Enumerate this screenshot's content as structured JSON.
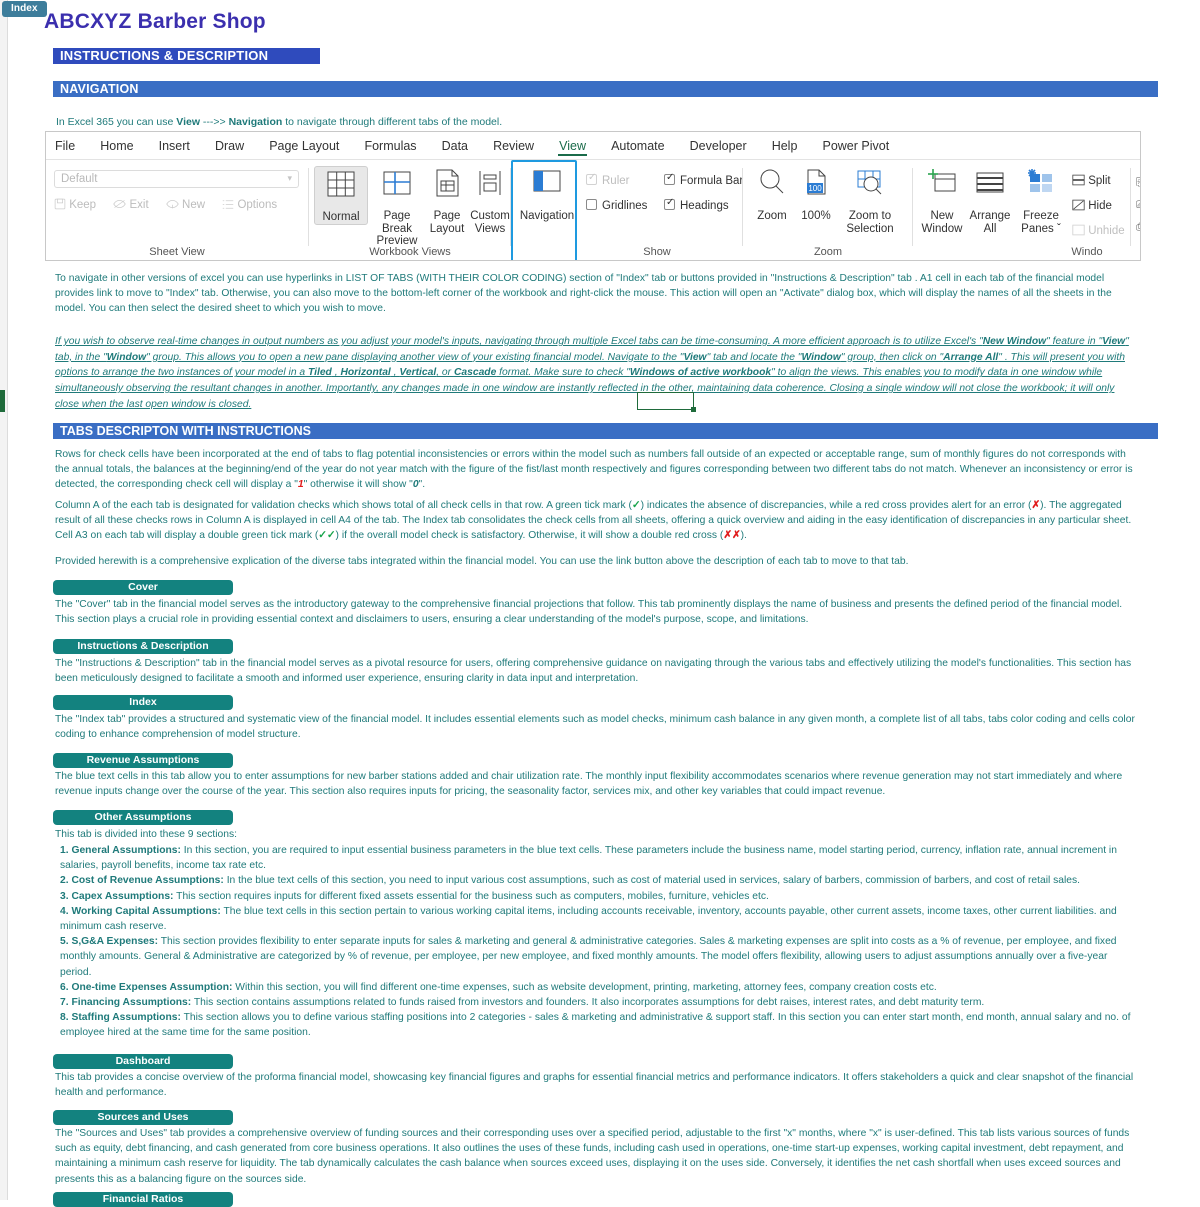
{
  "colors": {
    "teal_text": "#1f7a7a",
    "tab_button": "#13827f",
    "banner_dark_blue": "#2f4bbd",
    "banner_blue": "#3a6ec4",
    "title_purple": "#3b2fae",
    "index_tab": "#3d7d9b",
    "highlight_blue": "#1e9ae0",
    "error_red": "#e01b1b",
    "ok_green": "#16a34a"
  },
  "index_tab_label": "Index",
  "title": "ABCXYZ Barber Shop",
  "banners": {
    "instructions": "INSTRUCTIONS & DESCRIPTION",
    "navigation": "NAVIGATION",
    "tabs_description": "TABS DESCRIPTON WITH INSTRUCTIONS"
  },
  "intro": {
    "prefix": "In Excel 365 you can use ",
    "view": "View",
    "arrow": "  --->> ",
    "navigation": "Navigation",
    "suffix": " to navigate through different tabs of the model."
  },
  "ribbon": {
    "tabs": [
      "File",
      "Home",
      "Insert",
      "Draw",
      "Page Layout",
      "Formulas",
      "Data",
      "Review",
      "View",
      "Automate",
      "Developer",
      "Help",
      "Power Pivot"
    ],
    "active_tab": "View",
    "groups": {
      "sheet_view": {
        "label": "Sheet View",
        "dropdown_value": "Default",
        "buttons": [
          "Keep",
          "Exit",
          "New",
          "Options"
        ]
      },
      "workbook_views": {
        "label": "Workbook Views",
        "buttons": [
          "Normal",
          "Page Break Preview",
          "Page Layout",
          "Custom Views"
        ],
        "selected": "Normal"
      },
      "show": {
        "label": "Show",
        "checkboxes": [
          {
            "label": "Ruler",
            "checked": true,
            "disabled": true
          },
          {
            "label": "Formula Bar",
            "checked": true,
            "disabled": false
          },
          {
            "label": "Gridlines",
            "checked": false,
            "disabled": false
          },
          {
            "label": "Headings",
            "checked": true,
            "disabled": false
          }
        ],
        "navigation_button": "Navigation"
      },
      "zoom": {
        "label": "Zoom",
        "buttons": [
          "Zoom",
          "100%",
          "Zoom to Selection"
        ],
        "zoom_badge": "100"
      },
      "window": {
        "label": "Windo",
        "buttons": [
          "New Window",
          "Arrange All",
          "Freeze Panes"
        ],
        "freeze_caret": "ˇ",
        "small_buttons": [
          {
            "label": "Split",
            "disabled": false
          },
          {
            "label": "Hide",
            "disabled": false
          },
          {
            "label": "Unhide",
            "disabled": true
          }
        ]
      }
    }
  },
  "paragraphs": {
    "navigate_other_versions": "To navigate in other versions of excel you can use hyperlinks in LIST OF TABS (WITH THEIR COLOR CODING) section of \"Index\" tab or buttons provided in  \"Instructions & Description\" tab . A1 cell in each tab of the financial model provides link to move to \"Index\" tab. Otherwise, you can also move to the bottom-left corner of the workbook and right-click the mouse. This action will open an \"Activate\" dialog box, which will display the names of all the sheets in the model. You can then select the desired sheet to which you wish to move.",
    "new_window_italic": {
      "s1": "If you wish to observe real-time changes in output numbers as you adjust your model's inputs, navigating through multiple Excel tabs can be time-consuming. A more efficient approach is to utilize Excel's \"",
      "b1": "New Window",
      "s2": "\" feature in \"",
      "b2": "View",
      "s3": "\" tab, in the \"",
      "b3": "Window",
      "s4": "\" group. This allows you to open a new pane displaying another view of your existing financial model. Navigate to the \"",
      "b4": "View",
      "s5": "\" tab and locate the \"",
      "b5": "Window",
      "s6": "\" group, then click on \"",
      "b6": "Arrange All",
      "s7": "\" . This will present you with options to arrange the two instances of your model in a ",
      "b7": "Tiled",
      "s8": " , ",
      "b8": "Horizontal",
      "s9": " , ",
      "b9": "Vertical",
      "s10": ", or ",
      "b10": "Cascade",
      "s11": " format. Make sure to check \"",
      "b11": "Windows of active workbook",
      "s12": "\" to align the views. This  enables you to modify data in one window while simultaneously observing the resultant changes in another. Importantly, any changes made in one window are instantly reflected in the other, maintaining data coherence. Closing a single window will not close the workbook; it will only close when the last open window is closed."
    },
    "check_cells": {
      "s1": "Rows for check cells have been incorporated at the end of tabs to flag potential inconsistencies or errors within the model such as numbers fall outside of an expected or acceptable range, sum of monthly figures do not corresponds with the annual totals, the balances at the beginning/end of the year do not year match with the figure of the fist/last month respectively and figures corresponding between two different tabs do not match. Whenever an inconsistency or error is detected, the corresponding check cell will display a \"",
      "one": "1",
      "s2": "\" otherwise it will show \"",
      "zero": "0",
      "s3": "\"."
    },
    "column_a": {
      "s1": "Column A of the each tab is designated for validation checks which shows total of all check cells in that row. A green tick mark (",
      "tick": "✓",
      "s2": ") indicates the absence of discrepancies, while a red cross provides alert for an error (",
      "cross": "✗",
      "s3": "). The aggregated result of all these checks rows in Column A is displayed in cell A4 of the tab. The Index tab consolidates the check cells from all sheets, offering a quick overview and aiding in the easy identification of discrepancies in any particular sheet. Cell A3 on each tab will display a double green tick mark (",
      "ticks": "✓✓",
      "s4": ") if the overall model check is satisfactory. Otherwise, it will show a double red cross (",
      "crosses": "✗✗",
      "s5": ")."
    },
    "provided_herewith": "Provided herewith is a comprehensive explication of the diverse tabs integrated within the financial model. You can use the link button above the description of each tab to move to that tab."
  },
  "tab_sections": [
    {
      "button": "Cover",
      "text": "The \"Cover\" tab in the financial model serves as the introductory gateway to the comprehensive financial projections that follow. This tab prominently displays the name of business and presents the defined period of the financial model. This section plays  a crucial role in providing essential context and disclaimers to users, ensuring a clear understanding of the model's purpose, scope, and limitations."
    },
    {
      "button": "Instructions & Description",
      "text": "The \"Instructions & Description\" tab in the financial model serves as a pivotal resource for users, offering comprehensive guidance on navigating through the various tabs and effectively utilizing the model's functionalities. This section has been meticulously designed to facilitate a smooth and informed user experience, ensuring clarity in data input and interpretation."
    },
    {
      "button": "Index",
      "text": "The \"Index tab\" provides a structured and systematic view of the financial model. It includes essential elements such as model checks, minimum cash balance in any given month, a complete list of all tabs, tabs color coding and cells color coding to enhance comprehension of model structure."
    },
    {
      "button": "Revenue Assumptions",
      "text": "The blue text cells in this tab allow you to enter assumptions for new barber stations added and chair utilization rate. The monthly input flexibility accommodates scenarios where revenue generation may not start immediately and where revenue inputs change over the course of the year. This section also requires inputs for pricing, the seasonality factor, services mix, and other key variables that could impact revenue."
    },
    {
      "button": "Other Assumptions",
      "intro": "This tab is divided into these 9 sections:",
      "items": [
        {
          "num": "1. General Assumptions:",
          "text": " In this section, you are required to input essential business parameters in the blue text cells. These parameters include the business name, model starting period, currency, inflation rate, annual increment in salaries, payroll benefits, income tax rate etc."
        },
        {
          "num": "2. Cost of Revenue Assumptions:",
          "text": " In the blue text cells of this section, you need to input various cost assumptions, such as cost of material used in services, salary of barbers, commission of barbers, and cost of retail sales."
        },
        {
          "num": "3. Capex Assumptions:",
          "text": " This section requires inputs for different fixed assets essential for the business such as computers, mobiles, furniture, vehicles etc."
        },
        {
          "num": "4. Working Capital Assumptions:",
          "text": " The blue text cells in this section pertain to various working capital items, including accounts receivable, inventory, accounts payable, other current assets, income taxes, other current liabilities. and minimum cash reserve."
        },
        {
          "num": "5. S,G&A Expenses:",
          "text": " This section provides flexibility to enter separate inputs for sales & marketing and general & administrative categories. Sales & marketing expenses are split into costs as a % of revenue, per employee, and fixed monthly amounts. General & Administrative are categorized by % of revenue, per employee, per new employee, and fixed monthly amounts. The model offers flexibility, allowing users to adjust assumptions annually  over a  five-year period."
        },
        {
          "num": "6. One-time Expenses Assumption:",
          "text": " Within this section, you will find different one-time expenses, such as website development, printing, marketing, attorney fees, company creation costs etc."
        },
        {
          "num": "7. Financing Assumptions:",
          "text": " This section contains assumptions related to funds raised from investors and founders. It also incorporates assumptions for debt raises, interest rates, and debt maturity term."
        },
        {
          "num": "8. Staffing Assumptions:",
          "text": " This section allows you to define various staffing positions into 2 categories - sales & marketing and administrative & support staff. In this section you can enter start month, end month, annual salary and no. of employee hired at  the same time for the same position."
        }
      ]
    },
    {
      "button": "Dashboard",
      "text": "This tab provides a concise overview of the proforma financial model, showcasing key financial figures and graphs for essential financial metrics and performance indicators. It offers stakeholders a quick and clear snapshot of the financial health and performance."
    },
    {
      "button": "Sources and Uses",
      "text": "The \"Sources and Uses\" tab provides a comprehensive overview of funding sources and their corresponding uses over a specified period, adjustable to the first \"x\" months, where \"x\" is user-defined. This tab lists various sources of funds such as equity, debt financing, and cash generated from core business operations. It also outlines the uses of these funds, including cash used in operations, one-time start-up expenses, working capital investment, debt repayment, and maintaining  a minimum cash reserve for liquidity. The tab dynamically calculates the cash balance when sources exceed uses, displaying it on the uses side. Conversely, it identifies the net cash shortfall when uses exceed sources and presents this as a balancing figure on the sources side."
    },
    {
      "button": "Financial Ratios",
      "text": ""
    }
  ]
}
